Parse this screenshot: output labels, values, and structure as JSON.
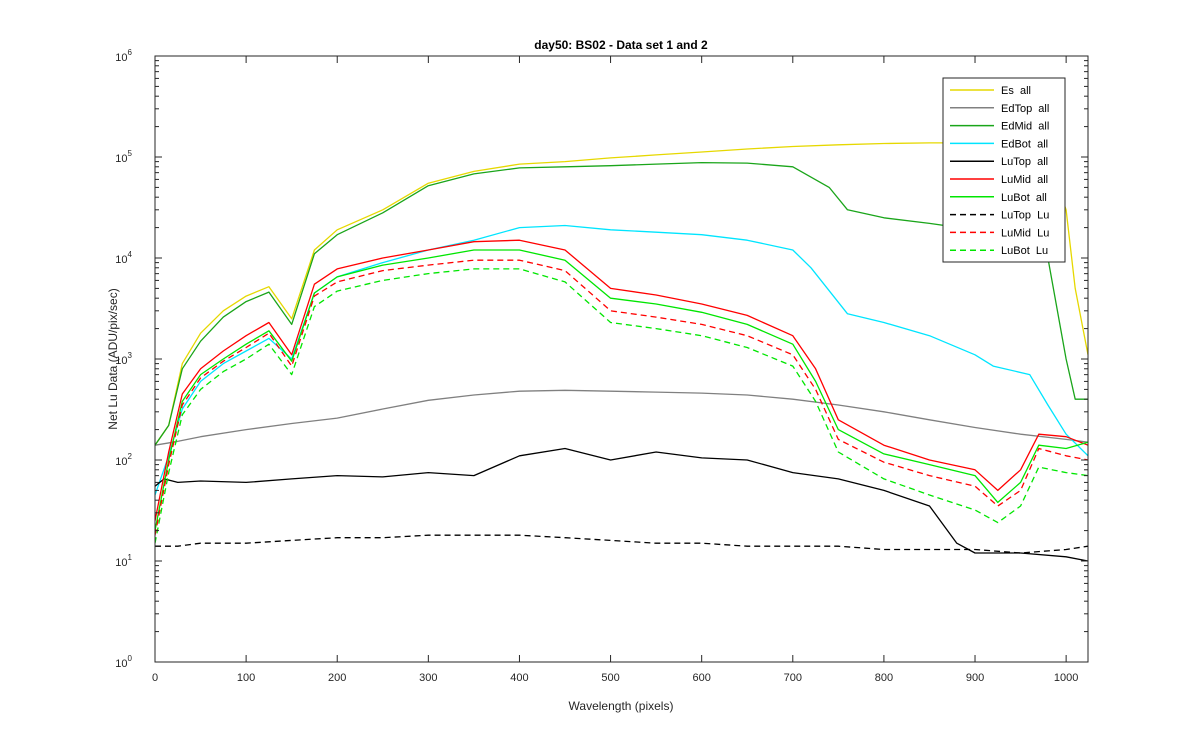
{
  "chart_data": {
    "type": "line",
    "title": "day50: BS02 - Data set 1 and 2",
    "xlabel": "Wavelength (pixels)",
    "ylabel": "Net Lu Data (ADU/pix/sec)",
    "xlim": [
      0,
      1024
    ],
    "ylim": [
      1,
      1000000
    ],
    "y_scale": "log",
    "grid": false,
    "legend_placement": "top-right",
    "x_ticks": [
      0,
      100,
      200,
      300,
      400,
      500,
      600,
      700,
      800,
      900,
      1000
    ],
    "y_ticks": [
      {
        "value": 1,
        "base": "10",
        "exp": "0"
      },
      {
        "value": 10,
        "base": "10",
        "exp": "1"
      },
      {
        "value": 100,
        "base": "10",
        "exp": "2"
      },
      {
        "value": 1000,
        "base": "10",
        "exp": "3"
      },
      {
        "value": 10000,
        "base": "10",
        "exp": "4"
      },
      {
        "value": 100000,
        "base": "10",
        "exp": "5"
      },
      {
        "value": 1000000,
        "base": "10",
        "exp": "6"
      }
    ],
    "series": [
      {
        "name": "Es  all",
        "color": "#e6d800",
        "dash": "solid",
        "x": [
          0,
          15,
          30,
          50,
          75,
          100,
          125,
          150,
          175,
          200,
          250,
          300,
          350,
          400,
          450,
          500,
          550,
          600,
          650,
          700,
          750,
          800,
          850,
          900,
          950,
          980,
          1000,
          1010,
          1024
        ],
        "y": [
          140,
          220,
          900,
          1800,
          3000,
          4200,
          5200,
          2500,
          12000,
          19000,
          30000,
          55000,
          72000,
          85000,
          90000,
          98000,
          105000,
          112000,
          120000,
          127000,
          132000,
          136000,
          138000,
          138000,
          135000,
          100000,
          30000,
          5000,
          1100
        ]
      },
      {
        "name": "EdTop  all",
        "color": "#808080",
        "dash": "solid",
        "x": [
          0,
          20,
          50,
          100,
          150,
          200,
          250,
          300,
          350,
          400,
          450,
          500,
          550,
          600,
          650,
          700,
          750,
          800,
          850,
          900,
          950,
          1000,
          1024
        ],
        "y": [
          140,
          150,
          170,
          200,
          230,
          260,
          320,
          390,
          440,
          480,
          490,
          480,
          470,
          460,
          440,
          400,
          350,
          300,
          250,
          210,
          180,
          160,
          150
        ]
      },
      {
        "name": "EdMid  all",
        "color": "#1aa51a",
        "dash": "solid",
        "x": [
          0,
          15,
          30,
          50,
          75,
          100,
          125,
          150,
          175,
          200,
          250,
          300,
          350,
          400,
          450,
          500,
          550,
          600,
          650,
          700,
          740,
          760,
          800,
          850,
          900,
          950,
          980,
          1000,
          1010,
          1024
        ],
        "y": [
          140,
          220,
          800,
          1500,
          2600,
          3700,
          4600,
          2200,
          11000,
          17000,
          28000,
          52000,
          68000,
          78000,
          80000,
          82000,
          85000,
          88000,
          87000,
          80000,
          50000,
          30000,
          25000,
          22000,
          19000,
          16000,
          10000,
          1000,
          400,
          400
        ]
      },
      {
        "name": "EdBot  all",
        "color": "#00e5ff",
        "dash": "solid",
        "x": [
          0,
          15,
          30,
          50,
          75,
          100,
          125,
          150,
          175,
          200,
          250,
          300,
          350,
          400,
          450,
          500,
          550,
          600,
          650,
          700,
          720,
          760,
          800,
          850,
          900,
          920,
          960,
          980,
          1000,
          1024
        ],
        "y": [
          45,
          110,
          320,
          600,
          900,
          1200,
          1600,
          1000,
          4500,
          6500,
          9000,
          12000,
          15000,
          20000,
          21000,
          19000,
          18000,
          17000,
          15000,
          12000,
          8000,
          2800,
          2300,
          1700,
          1100,
          850,
          700,
          350,
          180,
          110
        ]
      },
      {
        "name": "LuTop  all",
        "color": "#000000",
        "dash": "solid",
        "x": [
          0,
          10,
          25,
          50,
          100,
          150,
          200,
          250,
          300,
          350,
          400,
          450,
          500,
          550,
          600,
          650,
          700,
          750,
          800,
          850,
          880,
          900,
          950,
          1000,
          1024
        ],
        "y": [
          55,
          65,
          60,
          62,
          60,
          65,
          70,
          68,
          75,
          70,
          110,
          130,
          100,
          120,
          105,
          100,
          75,
          65,
          50,
          35,
          15,
          12,
          12,
          11,
          10
        ]
      },
      {
        "name": "LuMid  all",
        "color": "#ff0000",
        "dash": "solid",
        "x": [
          0,
          15,
          30,
          50,
          75,
          100,
          125,
          150,
          175,
          200,
          250,
          300,
          350,
          400,
          450,
          500,
          550,
          600,
          650,
          700,
          725,
          750,
          800,
          850,
          900,
          925,
          950,
          970,
          1000,
          1024
        ],
        "y": [
          25,
          120,
          450,
          800,
          1200,
          1700,
          2300,
          1100,
          5500,
          7800,
          10000,
          12000,
          14500,
          15000,
          12000,
          5000,
          4300,
          3500,
          2700,
          1700,
          800,
          250,
          140,
          100,
          80,
          50,
          80,
          180,
          170,
          140
        ]
      },
      {
        "name": "LuBot  all",
        "color": "#00e600",
        "dash": "solid",
        "x": [
          0,
          15,
          30,
          50,
          75,
          100,
          125,
          150,
          175,
          200,
          250,
          300,
          350,
          400,
          450,
          500,
          550,
          600,
          650,
          700,
          725,
          750,
          800,
          850,
          900,
          925,
          950,
          970,
          1000,
          1024
        ],
        "y": [
          20,
          100,
          380,
          700,
          1000,
          1400,
          1900,
          950,
          4500,
          6500,
          8500,
          10000,
          12000,
          12000,
          9500,
          4000,
          3500,
          2900,
          2200,
          1400,
          600,
          200,
          115,
          90,
          70,
          38,
          60,
          140,
          130,
          150
        ]
      },
      {
        "name": "LuTop  Lu",
        "color": "#000000",
        "dash": "dashed",
        "x": [
          0,
          25,
          50,
          100,
          150,
          200,
          250,
          300,
          350,
          400,
          450,
          500,
          550,
          600,
          650,
          700,
          750,
          800,
          850,
          900,
          950,
          1000,
          1024
        ],
        "y": [
          14,
          14,
          15,
          15,
          16,
          17,
          17,
          18,
          18,
          18,
          17,
          16,
          15,
          15,
          14,
          14,
          14,
          13,
          13,
          13,
          12,
          13,
          14
        ]
      },
      {
        "name": "LuMid  Lu",
        "color": "#ff0000",
        "dash": "dashed",
        "x": [
          0,
          15,
          30,
          50,
          75,
          100,
          125,
          150,
          175,
          200,
          250,
          300,
          350,
          400,
          450,
          500,
          550,
          600,
          650,
          700,
          725,
          750,
          800,
          850,
          900,
          925,
          950,
          970,
          1000,
          1024
        ],
        "y": [
          18,
          90,
          350,
          650,
          950,
          1300,
          1800,
          850,
          4200,
          5800,
          7500,
          8500,
          9500,
          9500,
          7500,
          3000,
          2600,
          2200,
          1700,
          1100,
          500,
          160,
          95,
          70,
          55,
          35,
          50,
          130,
          110,
          100
        ]
      },
      {
        "name": "LuBot  Lu",
        "color": "#00e600",
        "dash": "dashed",
        "x": [
          0,
          15,
          30,
          50,
          75,
          100,
          125,
          150,
          175,
          200,
          250,
          300,
          350,
          400,
          450,
          500,
          550,
          600,
          650,
          700,
          725,
          750,
          800,
          850,
          900,
          925,
          950,
          970,
          1000,
          1024
        ],
        "y": [
          15,
          75,
          280,
          500,
          750,
          1000,
          1400,
          700,
          3300,
          4700,
          6000,
          7000,
          7800,
          7800,
          5800,
          2300,
          2000,
          1700,
          1300,
          850,
          380,
          120,
          65,
          45,
          32,
          24,
          35,
          85,
          75,
          70
        ]
      }
    ]
  }
}
